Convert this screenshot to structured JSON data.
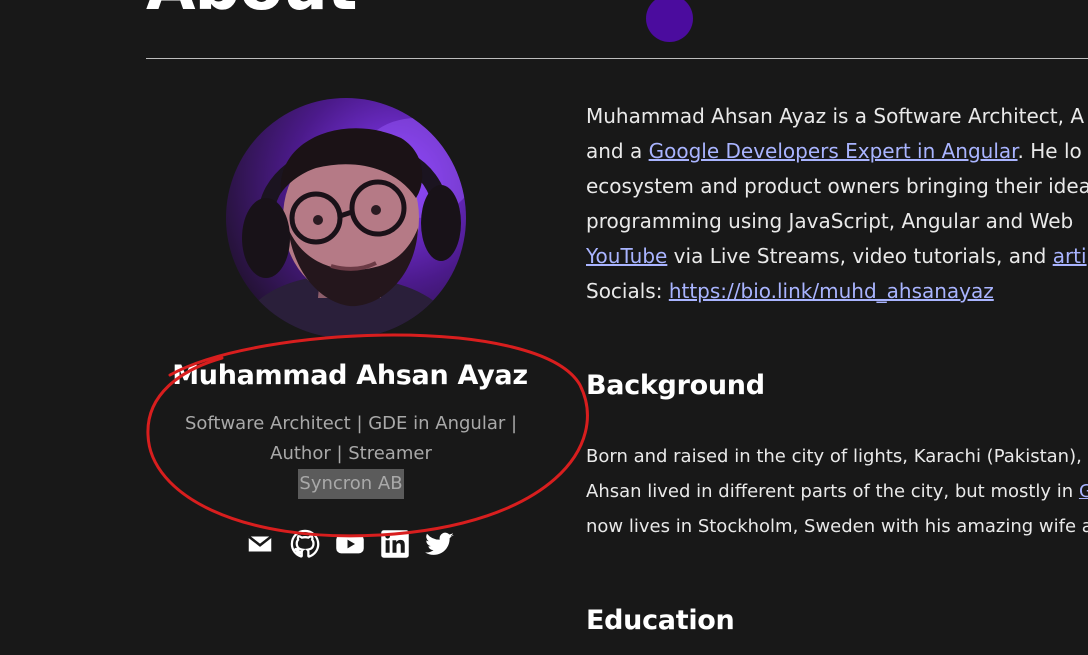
{
  "page": {
    "heading": "About"
  },
  "profile": {
    "name": "Muhammad Ahsan Ayaz",
    "role_line1": "Software Architect | GDE in Angular |",
    "role_line2": "Author | Streamer",
    "company": "Syncron AB",
    "socials": [
      "email-icon",
      "github-icon",
      "youtube-icon",
      "linkedin-icon",
      "twitter-icon"
    ]
  },
  "bio": {
    "line1": "Muhammad Ahsan Ayaz is a Software Architect, A",
    "line2_pre": "and a ",
    "line2_link": "Google Developers Expert in Angular",
    "line2_post": ". He lo",
    "line3": "ecosystem and product owners bringing their idea",
    "line4": "programming using JavaScript, Angular and Web",
    "line5_link1": "YouTube",
    "line5_mid": " via Live Streams, video tutorials, and ",
    "line5_link2": "arti",
    "line6_pre": "Socials: ",
    "line6_link": "https://bio.link/muhd_ahsanayaz"
  },
  "background": {
    "title": "Background",
    "line1": "Born and raised in the city of lights, Karachi (Pakistan), b",
    "line2_pre": "Ahsan lived in different parts of the city, but mostly in ",
    "line2_link": "Gu",
    "line3": "now lives in Stockholm, Sweden with his amazing wife a"
  },
  "education": {
    "title": "Education"
  },
  "colors": {
    "background": "#181818",
    "accent_dot": "#4b0c9e",
    "link": "#a9b4ff",
    "annotation": "#d81e1e"
  }
}
